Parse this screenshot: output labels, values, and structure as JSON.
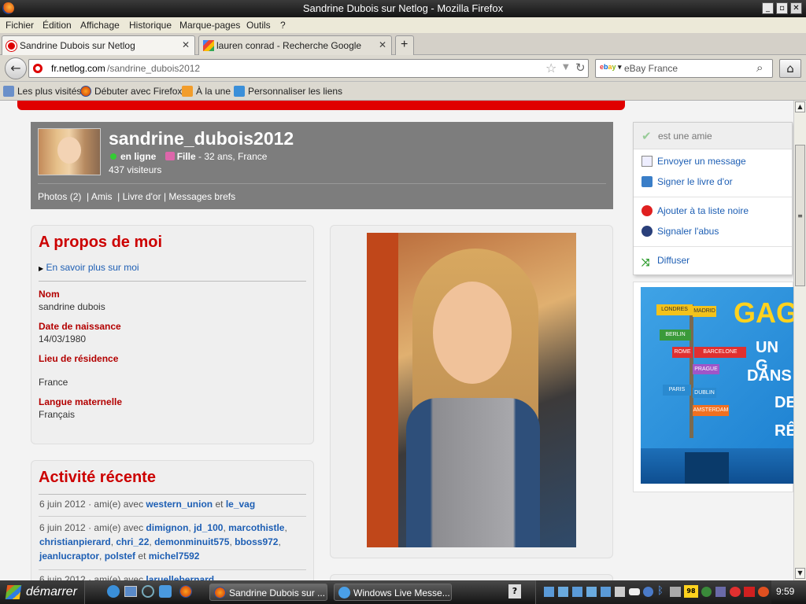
{
  "window": {
    "title": "Sandrine Dubois sur Netlog - Mozilla Firefox"
  },
  "menu": [
    "Fichier",
    "Édition",
    "Affichage",
    "Historique",
    "Marque-pages",
    "Outils",
    "?"
  ],
  "tabs": [
    {
      "label": "Sandrine Dubois sur Netlog"
    },
    {
      "label": "lauren conrad - Recherche Google"
    }
  ],
  "nav": {
    "url_host": "fr.netlog.com",
    "url_path": "/sandrine_dubois2012",
    "search_placeholder": "eBay France"
  },
  "bookmarks": [
    "Les plus visités",
    "Débuter avec Firefox",
    "À la une",
    "Personnaliser les liens"
  ],
  "profile": {
    "username": "sandrine_dubois2012",
    "status": "en ligne",
    "gender": "Fille",
    "details": "- 32 ans, France",
    "visitors": "437 visiteurs",
    "tabs": [
      "Photos (2)",
      "Amis",
      "Livre d'or",
      "Messages brefs"
    ]
  },
  "about": {
    "title": "A propos de moi",
    "more_link": "En savoir plus sur moi",
    "fields": [
      {
        "label": "Nom",
        "value": "sandrine dubois"
      },
      {
        "label": "Date de naissance",
        "value": "14/03/1980"
      },
      {
        "label": "Lieu de résidence",
        "value": ""
      },
      {
        "label": "",
        "value": "France"
      },
      {
        "label": "Langue maternelle",
        "value": "Français"
      }
    ]
  },
  "activity": {
    "title": "Activité récente",
    "items": [
      {
        "date": "6 juin 2012",
        "text": "· ami(e) avec",
        "links": [
          "western_union",
          "le_vag"
        ]
      },
      {
        "date": "6 juin 2012",
        "text": "· ami(e) avec",
        "links": [
          "dimignon",
          "jd_100",
          "marcothistle",
          "christianpierard",
          "chri_22",
          "demonminuit575",
          "bboss972",
          "jeanlucraptor",
          "polstef",
          "michel7592"
        ]
      },
      {
        "date": "6 juin 2012",
        "text": "· ami(e) avec",
        "links": [
          "laruellebernard"
        ]
      }
    ],
    "and_word": "et"
  },
  "side_menu": {
    "friend_status": "est une amie",
    "items": [
      {
        "label": "Envoyer un message",
        "icon": "envelope-icon"
      },
      {
        "label": "Signer le livre d'or",
        "icon": "book-icon"
      },
      {
        "label": "Ajouter à ta liste noire",
        "icon": "blacklist-icon"
      },
      {
        "label": "Signaler l'abus",
        "icon": "police-icon"
      },
      {
        "label": "Diffuser",
        "icon": "share-icon"
      }
    ]
  },
  "ad": {
    "headline": "GAG",
    "line1": "UN G",
    "line2": "DANS",
    "line3": "DE",
    "line4": "RÊ",
    "signs": [
      "LONDRES",
      "MADRID",
      "BERLIN",
      "ROME",
      "BARCELONE",
      "PRAGUE",
      "PARIS",
      "DUBLIN",
      "AMSTERDAM"
    ]
  },
  "taskbar": {
    "start": "démarrer",
    "windows": [
      "Sandrine Dubois sur ...",
      "Windows Live Messe..."
    ],
    "clock": "9:59"
  },
  "colors": {
    "accent": "#cc0000",
    "link": "#1e5fb4",
    "header_bg": "#808080"
  }
}
